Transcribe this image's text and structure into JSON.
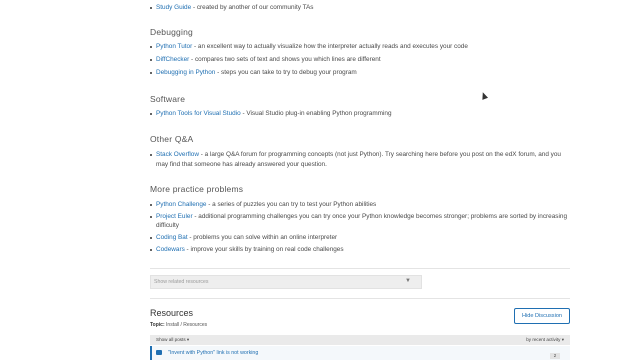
{
  "intro_item": {
    "link": "Study Guide",
    "text": " - created by another of our community TAs"
  },
  "sections": [
    {
      "title": "Debugging",
      "items": [
        {
          "link": "Python Tutor",
          "text": " - an excellent way to actually visualize how the interpreter actually reads and executes your code"
        },
        {
          "link": "DiffChecker",
          "text": " - compares two sets of text and shows you which lines are different"
        },
        {
          "link": "Debugging in Python",
          "text": " - steps you can take to try to debug your program"
        }
      ]
    },
    {
      "title": "Software",
      "items": [
        {
          "link": "Python Tools for Visual Studio",
          "text": " - Visual Studio plug-in enabling Python programming"
        }
      ]
    },
    {
      "title": "Other Q&A",
      "items": [
        {
          "link": "Stack Overflow",
          "text": " - a large Q&A forum for programming concepts (not just Python). Try searching here before you post on the edX forum, and you may find that someone has already answered your question."
        }
      ]
    },
    {
      "title": "More practice problems",
      "items": [
        {
          "link": "Python Challenge",
          "text": " - a series of puzzles you can try to test your Python abilities"
        },
        {
          "link": "Project Euler",
          "text": " - additional programming challenges you can try once your Python knowledge becomes stronger; problems are sorted by increasing difficulty"
        },
        {
          "link": "Coding Bat",
          "text": " - problems you can solve within an online interpreter"
        },
        {
          "link": "Codewars",
          "text": " - improve your skills by training on real code challenges"
        }
      ]
    }
  ],
  "related_resources": {
    "label": "Show related resources",
    "caret": "▼"
  },
  "discussion": {
    "title": "Resources",
    "topic_label": "Topic:",
    "topic_value": "Install / Resources",
    "hide_button": "Hide Discussion",
    "filter_left": "Show all posts",
    "filter_left_caret": "▾",
    "filter_right": "by recent activity",
    "filter_right_caret": "▾",
    "post_title": "\"Invent with Python\" link is not working",
    "post_count": "2"
  }
}
